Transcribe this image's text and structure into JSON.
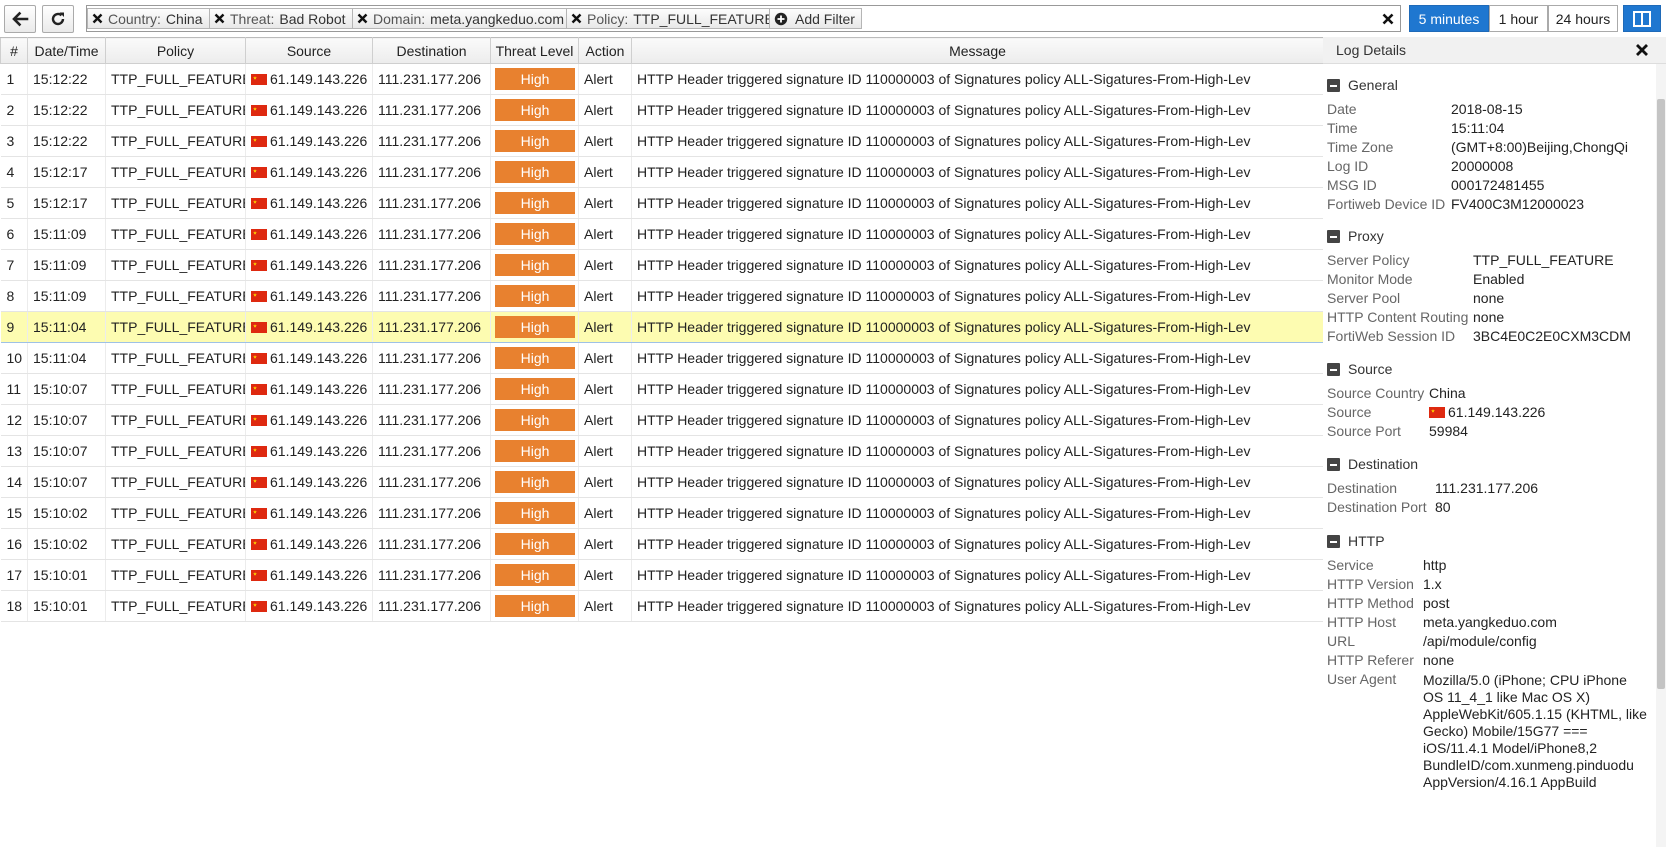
{
  "toolbar": {
    "back_icon": "arrow-left-icon",
    "refresh_icon": "refresh-icon",
    "filters": [
      {
        "key": "Country:",
        "value": "China"
      },
      {
        "key": "Threat:",
        "value": "Bad Robot"
      },
      {
        "key": "Domain:",
        "value": "meta.yangkeduo.com"
      },
      {
        "key": "Policy:",
        "value": "TTP_FULL_FEATURE"
      }
    ],
    "add_filter_label": "Add Filter",
    "time_ranges": [
      "5 minutes",
      "1 hour",
      "24 hours"
    ],
    "active_range": "5 minutes",
    "accent_color": "#1f77d0"
  },
  "table": {
    "columns": [
      "#",
      "Date/Time",
      "Policy",
      "Source",
      "Destination",
      "Threat Level",
      "Action",
      "Message"
    ],
    "selected_row": "9",
    "rows": [
      {
        "n": "1",
        "time": "15:12:22",
        "policy": "TTP_FULL_FEATURE",
        "source": "61.149.143.226",
        "dest": "111.231.177.206",
        "level": "High",
        "action": "Alert",
        "msg": "HTTP Header triggered signature ID 110000003 of Signatures policy ALL-Sigatures-From-High-Lev"
      },
      {
        "n": "2",
        "time": "15:12:22",
        "policy": "TTP_FULL_FEATURE",
        "source": "61.149.143.226",
        "dest": "111.231.177.206",
        "level": "High",
        "action": "Alert",
        "msg": "HTTP Header triggered signature ID 110000003 of Signatures policy ALL-Sigatures-From-High-Lev"
      },
      {
        "n": "3",
        "time": "15:12:22",
        "policy": "TTP_FULL_FEATURE",
        "source": "61.149.143.226",
        "dest": "111.231.177.206",
        "level": "High",
        "action": "Alert",
        "msg": "HTTP Header triggered signature ID 110000003 of Signatures policy ALL-Sigatures-From-High-Lev"
      },
      {
        "n": "4",
        "time": "15:12:17",
        "policy": "TTP_FULL_FEATURE",
        "source": "61.149.143.226",
        "dest": "111.231.177.206",
        "level": "High",
        "action": "Alert",
        "msg": "HTTP Header triggered signature ID 110000003 of Signatures policy ALL-Sigatures-From-High-Lev"
      },
      {
        "n": "5",
        "time": "15:12:17",
        "policy": "TTP_FULL_FEATURE",
        "source": "61.149.143.226",
        "dest": "111.231.177.206",
        "level": "High",
        "action": "Alert",
        "msg": "HTTP Header triggered signature ID 110000003 of Signatures policy ALL-Sigatures-From-High-Lev"
      },
      {
        "n": "6",
        "time": "15:11:09",
        "policy": "TTP_FULL_FEATURE",
        "source": "61.149.143.226",
        "dest": "111.231.177.206",
        "level": "High",
        "action": "Alert",
        "msg": "HTTP Header triggered signature ID 110000003 of Signatures policy ALL-Sigatures-From-High-Lev"
      },
      {
        "n": "7",
        "time": "15:11:09",
        "policy": "TTP_FULL_FEATURE",
        "source": "61.149.143.226",
        "dest": "111.231.177.206",
        "level": "High",
        "action": "Alert",
        "msg": "HTTP Header triggered signature ID 110000003 of Signatures policy ALL-Sigatures-From-High-Lev"
      },
      {
        "n": "8",
        "time": "15:11:09",
        "policy": "TTP_FULL_FEATURE",
        "source": "61.149.143.226",
        "dest": "111.231.177.206",
        "level": "High",
        "action": "Alert",
        "msg": "HTTP Header triggered signature ID 110000003 of Signatures policy ALL-Sigatures-From-High-Lev"
      },
      {
        "n": "9",
        "time": "15:11:04",
        "policy": "TTP_FULL_FEATURE",
        "source": "61.149.143.226",
        "dest": "111.231.177.206",
        "level": "High",
        "action": "Alert",
        "msg": "HTTP Header triggered signature ID 110000003 of Signatures policy ALL-Sigatures-From-High-Lev"
      },
      {
        "n": "10",
        "time": "15:11:04",
        "policy": "TTP_FULL_FEATURE",
        "source": "61.149.143.226",
        "dest": "111.231.177.206",
        "level": "High",
        "action": "Alert",
        "msg": "HTTP Header triggered signature ID 110000003 of Signatures policy ALL-Sigatures-From-High-Lev"
      },
      {
        "n": "11",
        "time": "15:10:07",
        "policy": "TTP_FULL_FEATURE",
        "source": "61.149.143.226",
        "dest": "111.231.177.206",
        "level": "High",
        "action": "Alert",
        "msg": "HTTP Header triggered signature ID 110000003 of Signatures policy ALL-Sigatures-From-High-Lev"
      },
      {
        "n": "12",
        "time": "15:10:07",
        "policy": "TTP_FULL_FEATURE",
        "source": "61.149.143.226",
        "dest": "111.231.177.206",
        "level": "High",
        "action": "Alert",
        "msg": "HTTP Header triggered signature ID 110000003 of Signatures policy ALL-Sigatures-From-High-Lev"
      },
      {
        "n": "13",
        "time": "15:10:07",
        "policy": "TTP_FULL_FEATURE",
        "source": "61.149.143.226",
        "dest": "111.231.177.206",
        "level": "High",
        "action": "Alert",
        "msg": "HTTP Header triggered signature ID 110000003 of Signatures policy ALL-Sigatures-From-High-Lev"
      },
      {
        "n": "14",
        "time": "15:10:07",
        "policy": "TTP_FULL_FEATURE",
        "source": "61.149.143.226",
        "dest": "111.231.177.206",
        "level": "High",
        "action": "Alert",
        "msg": "HTTP Header triggered signature ID 110000003 of Signatures policy ALL-Sigatures-From-High-Lev"
      },
      {
        "n": "15",
        "time": "15:10:02",
        "policy": "TTP_FULL_FEATURE",
        "source": "61.149.143.226",
        "dest": "111.231.177.206",
        "level": "High",
        "action": "Alert",
        "msg": "HTTP Header triggered signature ID 110000003 of Signatures policy ALL-Sigatures-From-High-Lev"
      },
      {
        "n": "16",
        "time": "15:10:02",
        "policy": "TTP_FULL_FEATURE",
        "source": "61.149.143.226",
        "dest": "111.231.177.206",
        "level": "High",
        "action": "Alert",
        "msg": "HTTP Header triggered signature ID 110000003 of Signatures policy ALL-Sigatures-From-High-Lev"
      },
      {
        "n": "17",
        "time": "15:10:01",
        "policy": "TTP_FULL_FEATURE",
        "source": "61.149.143.226",
        "dest": "111.231.177.206",
        "level": "High",
        "action": "Alert",
        "msg": "HTTP Header triggered signature ID 110000003 of Signatures policy ALL-Sigatures-From-High-Lev"
      },
      {
        "n": "18",
        "time": "15:10:01",
        "policy": "TTP_FULL_FEATURE",
        "source": "61.149.143.226",
        "dest": "111.231.177.206",
        "level": "High",
        "action": "Alert",
        "msg": "HTTP Header triggered signature ID 110000003 of Signatures policy ALL-Sigatures-From-High-Lev"
      }
    ],
    "level_color": "#e8812f",
    "selected_color": "#fdfcb1"
  },
  "details": {
    "title": "Log Details",
    "sections": [
      {
        "title": "General",
        "rows": [
          {
            "k": "Date",
            "v": "2018-08-15"
          },
          {
            "k": "Time",
            "v": "15:11:04"
          },
          {
            "k": "Time Zone",
            "v": "(GMT+8:00)Beijing,ChongQi"
          },
          {
            "k": "Log ID",
            "v": "20000008"
          },
          {
            "k": "MSG ID",
            "v": "000172481455"
          },
          {
            "k": "Fortiweb Device ID",
            "v": "FV400C3M12000023"
          }
        ]
      },
      {
        "title": "Proxy",
        "rows": [
          {
            "k": "Server Policy",
            "v": "TTP_FULL_FEATURE"
          },
          {
            "k": "Monitor Mode",
            "v": "Enabled"
          },
          {
            "k": "Server Pool",
            "v": "none"
          },
          {
            "k": "HTTP Content Routing",
            "v": "none"
          },
          {
            "k": "FortiWeb Session ID",
            "v": "3BC4E0C2E0CXM3CDM"
          }
        ]
      },
      {
        "title": "Source",
        "rows": [
          {
            "k": "Source Country",
            "v": "China"
          },
          {
            "k": "Source",
            "v": "61.149.143.226"
          },
          {
            "k": "Source Port",
            "v": "59984"
          }
        ]
      },
      {
        "title": "Destination",
        "rows": [
          {
            "k": "Destination",
            "v": "111.231.177.206"
          },
          {
            "k": "Destination Port",
            "v": "80"
          }
        ]
      },
      {
        "title": "HTTP",
        "rows": [
          {
            "k": "Service",
            "v": "http"
          },
          {
            "k": "HTTP Version",
            "v": "1.x"
          },
          {
            "k": "HTTP Method",
            "v": "post"
          },
          {
            "k": "HTTP Host",
            "v": "meta.yangkeduo.com"
          },
          {
            "k": "URL",
            "v": "/api/module/config"
          },
          {
            "k": "HTTP Referer",
            "v": "none"
          },
          {
            "k": "User Agent",
            "v": "Mozilla/5.0 (iPhone; CPU iPhone OS 11_4_1 like Mac OS X) AppleWebKit/605.1.15 (KHTML, like Gecko) Mobile/15G77 === iOS/11.4.1 Model/iPhone8,2 BundleID/com.xunmeng.pinduodu AppVersion/4.16.1 AppBuild"
          }
        ]
      }
    ]
  }
}
